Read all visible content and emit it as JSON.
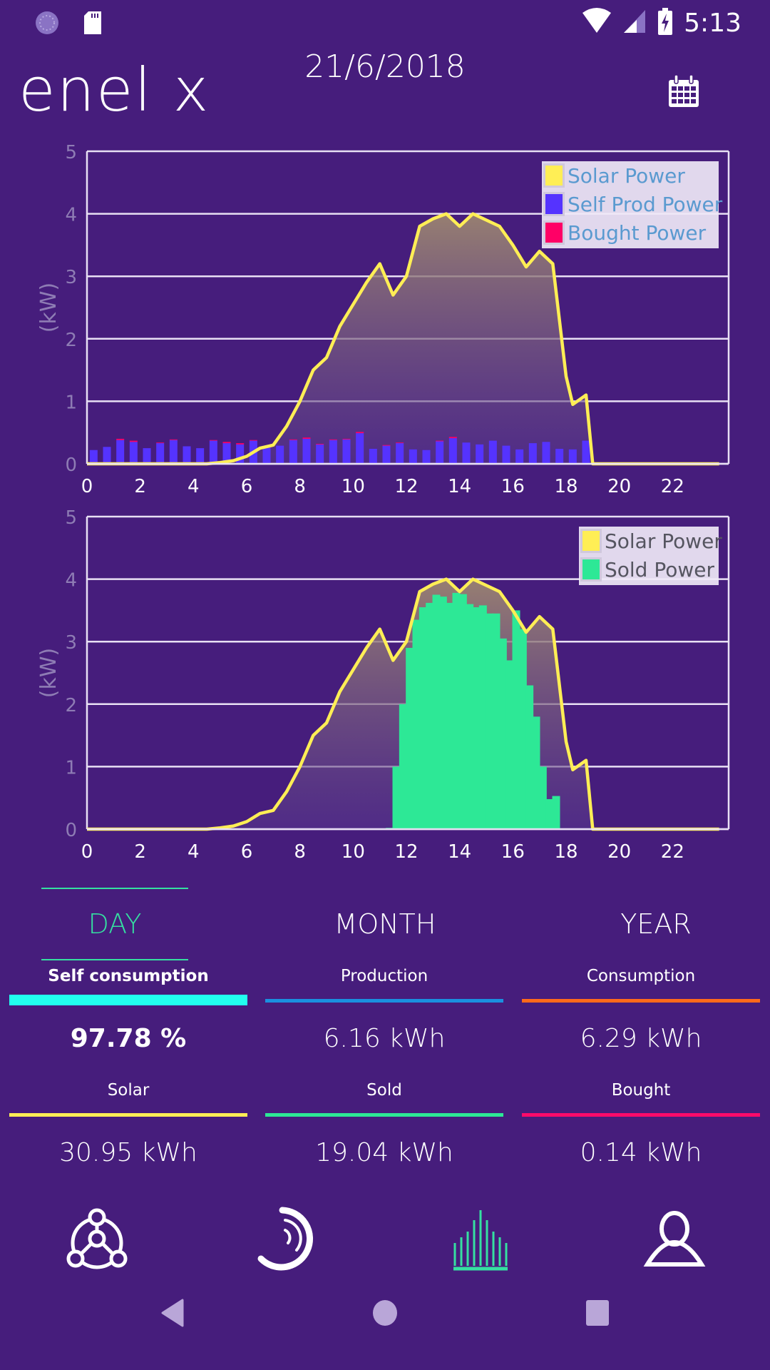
{
  "status_bar": {
    "time": "5:13",
    "icons": [
      "loading-icon",
      "sd-card-icon",
      "wifi-icon",
      "signal-icon",
      "battery-charging-icon"
    ]
  },
  "header": {
    "logo": "enel x",
    "date": "21/6/2018",
    "calendar_icon": "calendar-icon"
  },
  "colors": {
    "background": "#461d7c",
    "solar": "#ffee55",
    "self_prod": "#5533ff",
    "bought": "#ff0066",
    "sold": "#2de896",
    "tab_active": "#35e0a1",
    "self_consumption": "#22ffee",
    "production": "#1a90e0",
    "consumption": "#ff6a1a",
    "bought_bar": "#ff0a6a"
  },
  "chart_data": [
    {
      "type": "line+bar",
      "title": "",
      "ylabel": "(kW)",
      "xlabel": "",
      "xlim": [
        0,
        24
      ],
      "ylim": [
        0,
        5
      ],
      "xticks": [
        "0",
        "2",
        "4",
        "6",
        "8",
        "10",
        "12",
        "14",
        "16",
        "18",
        "20",
        "22"
      ],
      "yticks": [
        "0",
        "1",
        "2",
        "3",
        "4",
        "5"
      ],
      "grid": true,
      "legend_position": "top-right",
      "legend": [
        {
          "name": "Solar Power",
          "color": "#ffee55"
        },
        {
          "name": "Self Prod Power",
          "color": "#5533ff"
        },
        {
          "name": "Bought Power",
          "color": "#ff0066"
        }
      ],
      "series": [
        {
          "name": "Solar Power",
          "kind": "area-line",
          "x": [
            0,
            0.5,
            1,
            1.5,
            2,
            2.5,
            3,
            3.5,
            4,
            4.5,
            5,
            5.5,
            6,
            6.5,
            7,
            7.5,
            8,
            8.5,
            9,
            9.5,
            10,
            10.5,
            11,
            11.5,
            12,
            12.5,
            13,
            13.5,
            14,
            14.5,
            15,
            15.5,
            16,
            16.5,
            17,
            17.5,
            18,
            18.25,
            18.75,
            19,
            19.5,
            20,
            20.5,
            21,
            21.5,
            22,
            22.5,
            23,
            23.75
          ],
          "values": [
            0,
            0,
            0,
            0,
            0,
            0,
            0,
            0,
            0,
            0,
            0.02,
            0.05,
            0.12,
            0.25,
            0.3,
            0.6,
            1.0,
            1.5,
            1.7,
            2.2,
            2.55,
            2.9,
            3.2,
            2.7,
            3.0,
            3.8,
            3.92,
            4.0,
            3.8,
            4.0,
            3.9,
            3.8,
            3.5,
            3.15,
            3.4,
            3.2,
            1.4,
            0.95,
            1.1,
            0,
            0,
            0,
            0,
            0,
            0,
            0,
            0,
            0,
            0
          ]
        },
        {
          "name": "Self Prod Power",
          "kind": "bar",
          "x": [
            0,
            0.5,
            1,
            1.5,
            2,
            2.5,
            3,
            3.5,
            4,
            4.5,
            5,
            5.5,
            6,
            6.5,
            7,
            7.5,
            8,
            8.5,
            9,
            9.5,
            10,
            10.5,
            11,
            11.5,
            12,
            12.5,
            13,
            13.5,
            14,
            14.5,
            15,
            15.5,
            16,
            16.5,
            17,
            17.5,
            18,
            18.5
          ],
          "values": [
            0.22,
            0.27,
            0.38,
            0.35,
            0.25,
            0.33,
            0.38,
            0.28,
            0.25,
            0.37,
            0.33,
            0.31,
            0.37,
            0.26,
            0.29,
            0.38,
            0.4,
            0.31,
            0.38,
            0.39,
            0.49,
            0.24,
            0.29,
            0.33,
            0.23,
            0.22,
            0.36,
            0.41,
            0.34,
            0.31,
            0.37,
            0.29,
            0.23,
            0.33,
            0.35,
            0.24,
            0.23,
            0.37
          ]
        },
        {
          "name": "Bought Power",
          "kind": "bar-stack-top",
          "x": [
            0,
            0.5,
            1,
            1.5,
            2,
            2.5,
            3,
            3.5,
            4,
            4.5,
            5,
            5.5,
            6,
            6.5,
            7,
            7.5,
            8,
            8.5,
            9,
            9.5,
            10,
            10.5,
            11,
            11.5,
            12,
            12.5,
            13,
            13.5,
            14,
            14.5,
            15,
            15.5,
            16,
            16.5,
            17,
            17.5,
            18,
            18.5
          ],
          "values": [
            0,
            0,
            0.02,
            0.02,
            0,
            0.01,
            0.01,
            0,
            0,
            0.01,
            0.02,
            0.02,
            0.01,
            0.01,
            0,
            0.01,
            0.02,
            0.01,
            0.01,
            0.01,
            0.02,
            0,
            0.01,
            0.01,
            0,
            0,
            0.01,
            0.02,
            0,
            0,
            0,
            0,
            0,
            0,
            0,
            0,
            0,
            0
          ]
        }
      ]
    },
    {
      "type": "line+bar",
      "title": "",
      "ylabel": "(kW)",
      "xlabel": "",
      "xlim": [
        0,
        24
      ],
      "ylim": [
        0,
        5
      ],
      "xticks": [
        "0",
        "2",
        "4",
        "6",
        "8",
        "10",
        "12",
        "14",
        "16",
        "18",
        "20",
        "22"
      ],
      "yticks": [
        "0",
        "1",
        "2",
        "3",
        "4",
        "5"
      ],
      "grid": true,
      "legend_position": "top-right",
      "legend": [
        {
          "name": "Solar Power",
          "color": "#ffee55"
        },
        {
          "name": "Sold Power",
          "color": "#2de896"
        }
      ],
      "series": [
        {
          "name": "Solar Power",
          "kind": "area-line",
          "x": [
            0,
            0.5,
            1,
            1.5,
            2,
            2.5,
            3,
            3.5,
            4,
            4.5,
            5,
            5.5,
            6,
            6.5,
            7,
            7.5,
            8,
            8.5,
            9,
            9.5,
            10,
            10.5,
            11,
            11.5,
            12,
            12.5,
            13,
            13.5,
            14,
            14.5,
            15,
            15.5,
            16,
            16.5,
            17,
            17.5,
            18,
            18.25,
            18.75,
            19,
            19.5,
            20,
            20.5,
            21,
            21.5,
            22,
            22.5,
            23,
            23.75
          ],
          "values": [
            0,
            0,
            0,
            0,
            0,
            0,
            0,
            0,
            0,
            0,
            0.02,
            0.05,
            0.12,
            0.25,
            0.3,
            0.6,
            1.0,
            1.5,
            1.7,
            2.2,
            2.55,
            2.9,
            3.2,
            2.7,
            3.0,
            3.8,
            3.92,
            4.0,
            3.8,
            4.0,
            3.9,
            3.8,
            3.5,
            3.15,
            3.4,
            3.2,
            1.4,
            0.95,
            1.1,
            0,
            0,
            0,
            0,
            0,
            0,
            0,
            0,
            0,
            0
          ]
        },
        {
          "name": "Sold Power",
          "kind": "bar",
          "x": [
            8.75,
            9,
            9.5,
            11.25,
            11.5,
            11.75,
            12,
            12.25,
            12.5,
            12.75,
            13,
            13.25,
            13.5,
            13.75,
            14,
            14.25,
            14.5,
            14.75,
            15,
            15.25,
            15.5,
            15.75,
            16,
            16.25,
            16.5,
            16.75,
            17,
            17.25,
            17.5,
            17.75,
            18,
            18.25
          ],
          "values": [
            0.01,
            0.01,
            0.01,
            0.02,
            1.0,
            2.0,
            2.9,
            3.35,
            3.55,
            3.62,
            3.75,
            3.72,
            3.62,
            3.78,
            3.76,
            3.6,
            3.55,
            3.58,
            3.45,
            3.45,
            3.05,
            2.7,
            3.5,
            3.2,
            2.3,
            1.8,
            1.0,
            0.48,
            0.53,
            0,
            0,
            0
          ]
        }
      ]
    }
  ],
  "tabs": [
    {
      "label": "DAY",
      "active": true
    },
    {
      "label": "MONTH",
      "active": false
    },
    {
      "label": "YEAR",
      "active": false
    }
  ],
  "stats": [
    {
      "label": "Self consumption",
      "value": "97.78 %",
      "color": "#22ffee",
      "emphasis": true
    },
    {
      "label": "Production",
      "value": "6.16 kWh",
      "color": "#1a90e0",
      "emphasis": false
    },
    {
      "label": "Consumption",
      "value": "6.29 kWh",
      "color": "#ff6a1a",
      "emphasis": false
    },
    {
      "label": "Solar",
      "value": "30.95 kWh",
      "color": "#ffee55",
      "emphasis": false
    },
    {
      "label": "Sold",
      "value": "19.04 kWh",
      "color": "#2de896",
      "emphasis": false
    },
    {
      "label": "Bought",
      "value": "0.14 kWh",
      "color": "#ff0a6a",
      "emphasis": false
    }
  ],
  "bottom_nav": [
    {
      "name": "network-icon",
      "active": false
    },
    {
      "name": "energy-flow-icon",
      "active": false
    },
    {
      "name": "bar-chart-icon",
      "active": true
    },
    {
      "name": "profile-icon",
      "active": false
    }
  ],
  "system_nav": [
    "back-icon",
    "home-icon",
    "recents-icon"
  ]
}
